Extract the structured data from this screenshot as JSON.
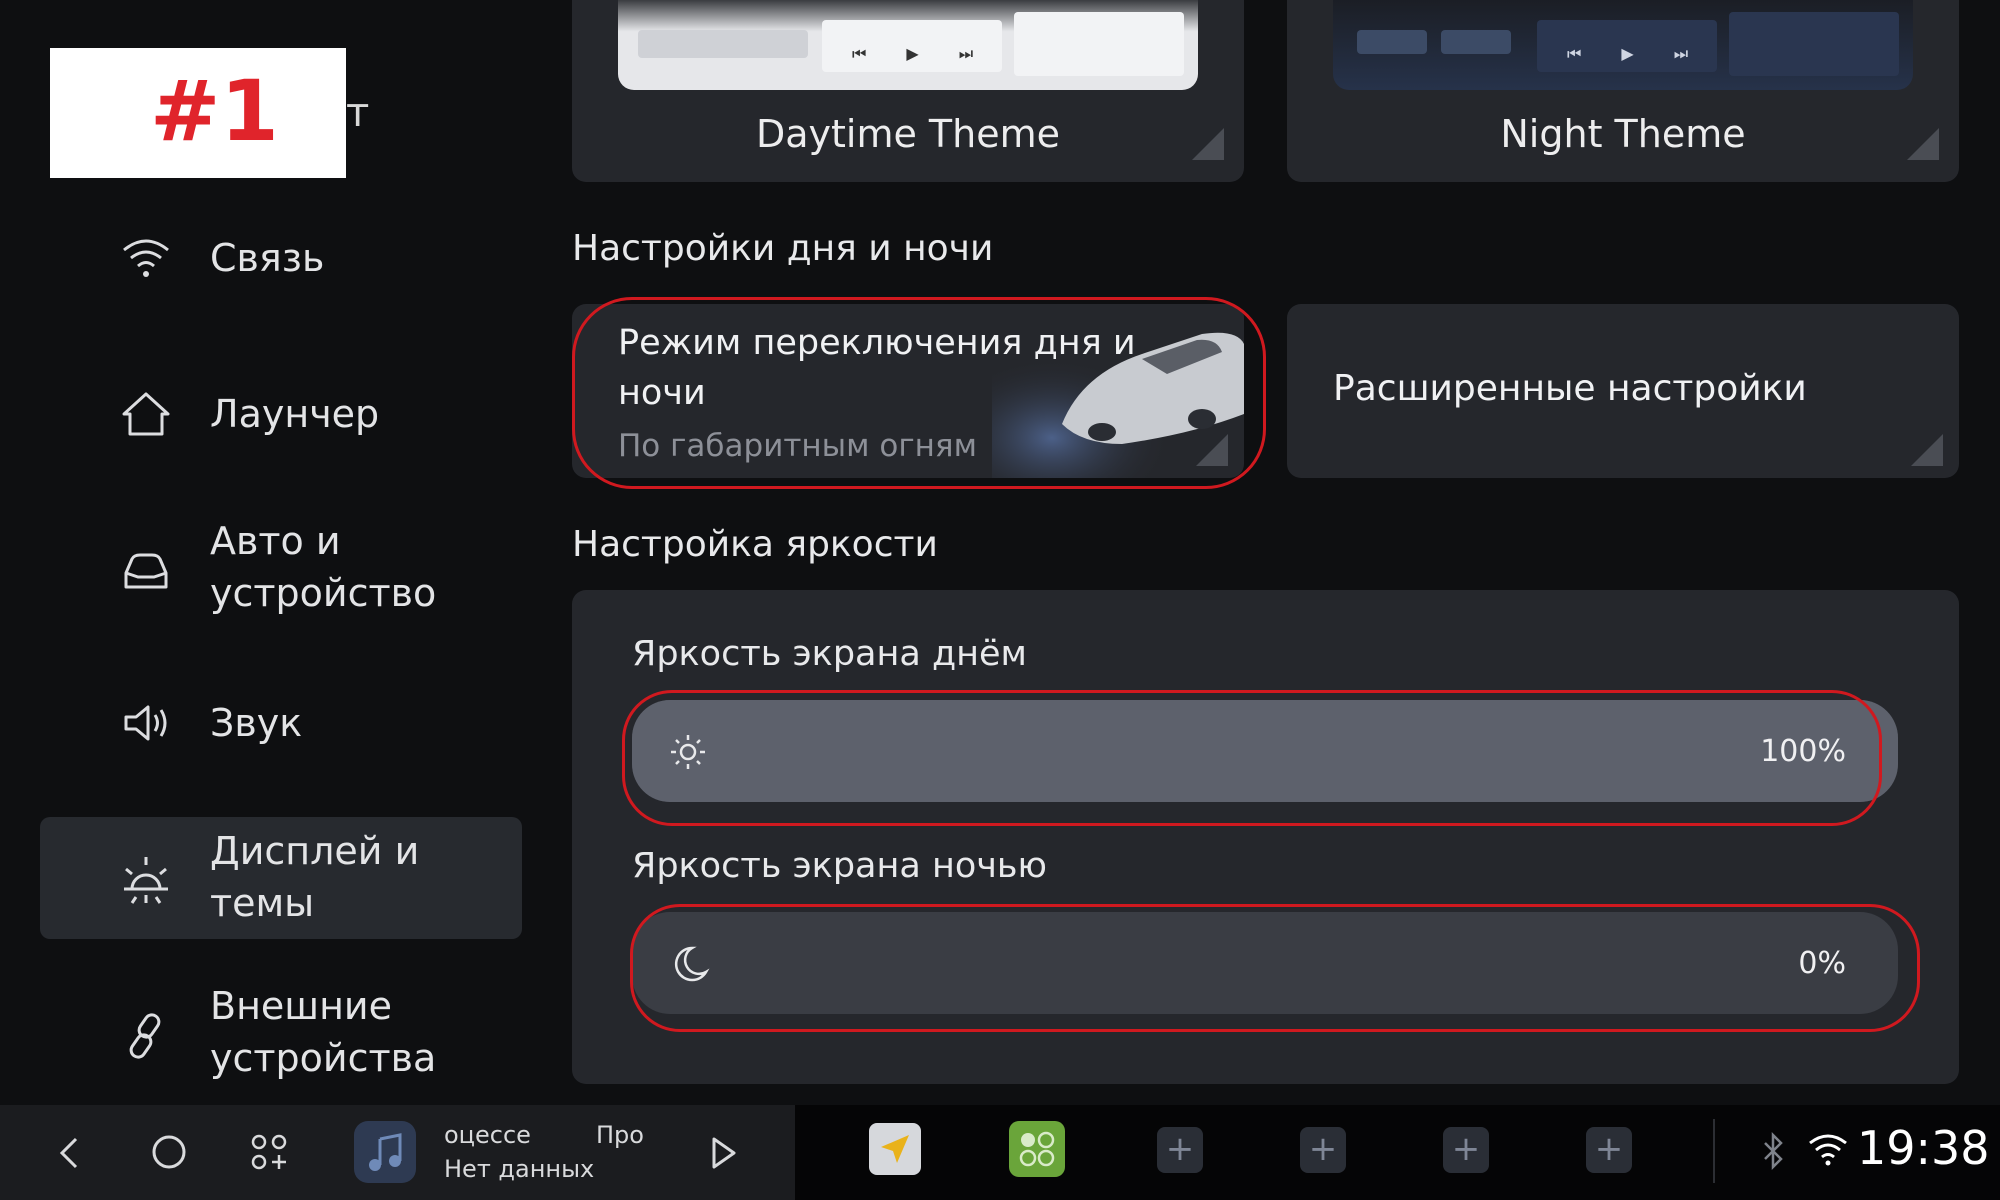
{
  "badge": {
    "label": "#1"
  },
  "sidebar": {
    "items": [
      {
        "label": "Связь",
        "icon": "wifi-icon"
      },
      {
        "label": "Лаунчер",
        "icon": "home-icon"
      },
      {
        "label": "Авто и\nустройство",
        "icon": "car-icon"
      },
      {
        "label": "Звук",
        "icon": "speaker-icon"
      },
      {
        "label": "Дисплей и\nтемы",
        "icon": "sun-icon",
        "active": true
      },
      {
        "label": "Внешние\nустройства",
        "icon": "link-icon"
      }
    ]
  },
  "themes": {
    "day": {
      "title": "Daytime Theme"
    },
    "night": {
      "title": "Night Theme"
    }
  },
  "day_night": {
    "section_title": "Настройки дня и ночи",
    "mode_title": "Режим переключения дня и ночи",
    "mode_value": "По габаритным огням",
    "advanced_title": "Расширенные настройки"
  },
  "brightness": {
    "section_title": "Настройка яркости",
    "day_label": "Яркость экрана днём",
    "day_value": 100,
    "day_text": "100%",
    "night_label": "Яркость экрана ночью",
    "night_value": 0,
    "night_text": "0%"
  },
  "bottom": {
    "media_line1": "оцессе",
    "media_line2": "Нет данных",
    "media_right": "Про",
    "time": "19:38"
  },
  "colors": {
    "accent_red": "#d0191f",
    "slider_day": "#5d616c",
    "slider_night": "#3a3d44",
    "panel": "#25272c"
  }
}
